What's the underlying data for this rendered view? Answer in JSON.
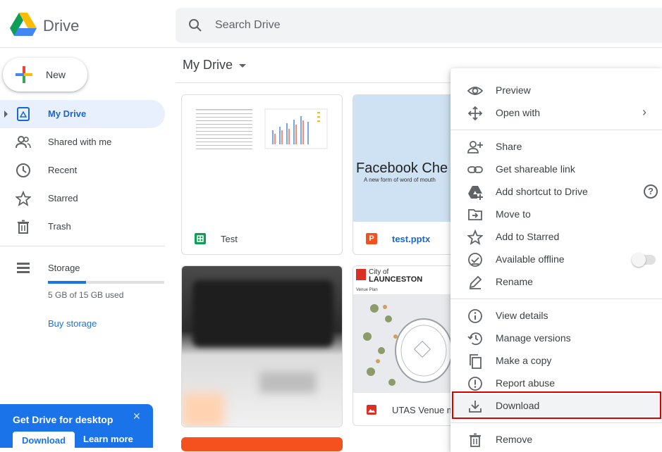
{
  "app": {
    "brand": "Drive"
  },
  "search": {
    "placeholder": "Search Drive"
  },
  "sidebar": {
    "new_label": "New",
    "items": [
      {
        "label": "My Drive",
        "icon": "my-drive-icon"
      },
      {
        "label": "Shared with me",
        "icon": "shared-icon"
      },
      {
        "label": "Recent",
        "icon": "clock-icon"
      },
      {
        "label": "Starred",
        "icon": "star-icon"
      },
      {
        "label": "Trash",
        "icon": "trash-icon"
      }
    ],
    "storage": {
      "label": "Storage",
      "used_text": "5 GB of 15 GB used",
      "used_fraction": 0.33,
      "buy_label": "Buy storage"
    }
  },
  "promo": {
    "title": "Get Drive for desktop",
    "download_label": "Download",
    "learn_label": "Learn more",
    "close": "✕"
  },
  "main": {
    "title": "My Drive",
    "files": [
      {
        "name": "Test",
        "type": "sheets",
        "color": "#0f9d58"
      },
      {
        "name": "test.pptx",
        "type": "powerpoint",
        "color": "#f4511e",
        "slide_title": "Facebook Che",
        "slide_subtitle": "A new form of word of mouth"
      },
      {
        "name": "",
        "type": "image"
      },
      {
        "name": "UTAS Venue m",
        "type": "image",
        "color": "#d93025",
        "doc_heading_1": "City of",
        "doc_heading_2": "LAUNCESTON",
        "doc_sub": "Venue Plan"
      }
    ]
  },
  "context_menu": {
    "items": [
      {
        "label": "Preview",
        "icon": "eye-icon"
      },
      {
        "label": "Open with",
        "icon": "move-arrows-icon",
        "submenu": "›"
      },
      {
        "label": "Share",
        "icon": "person-add-icon"
      },
      {
        "label": "Get shareable link",
        "icon": "link-icon"
      },
      {
        "label": "Add shortcut to Drive",
        "icon": "drive-shortcut-icon",
        "help": "?"
      },
      {
        "label": "Move to",
        "icon": "folder-move-icon"
      },
      {
        "label": "Add to Starred",
        "icon": "star-icon"
      },
      {
        "label": "Available offline",
        "icon": "offline-check-icon"
      },
      {
        "label": "Rename",
        "icon": "pencil-icon"
      },
      {
        "label": "View details",
        "icon": "info-icon"
      },
      {
        "label": "Manage versions",
        "icon": "history-icon"
      },
      {
        "label": "Make a copy",
        "icon": "copy-icon"
      },
      {
        "label": "Report abuse",
        "icon": "alert-icon"
      },
      {
        "label": "Download",
        "icon": "download-icon"
      },
      {
        "label": "Remove",
        "icon": "trash-icon"
      }
    ]
  },
  "colors": {
    "accent": "#1a73e8",
    "active_bg": "#e8f0fe",
    "highlight_outline": "#d50000"
  }
}
